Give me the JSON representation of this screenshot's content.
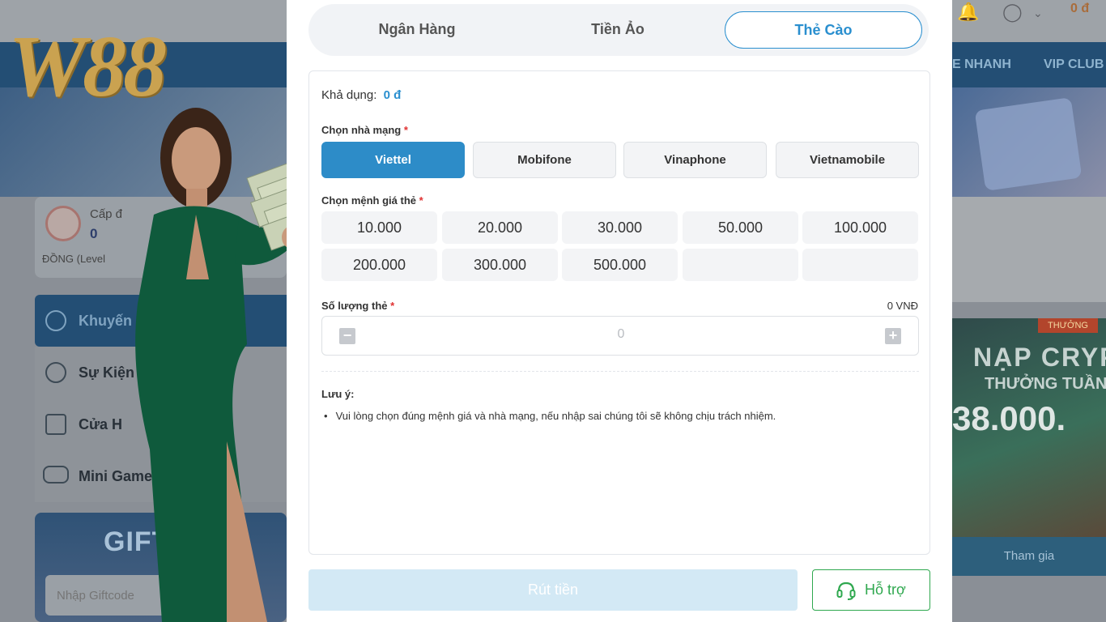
{
  "background": {
    "nav": {
      "items_right": [
        "E NHANH",
        "VIP CLUB"
      ]
    },
    "user_card": {
      "level_label": "Cấp đ",
      "points": "0",
      "level_name": "ĐỒNG (Level"
    },
    "menu": [
      {
        "label": "Khuyến"
      },
      {
        "label": "Sự Kiện"
      },
      {
        "label": "Cửa H"
      },
      {
        "label": "Mini Game"
      }
    ],
    "gift": {
      "title": "GIFT",
      "placeholder": "Nhập Giftcode"
    },
    "promo": {
      "badge": "THƯỞNG",
      "line1": "NẠP CRYP",
      "line2": "THƯỞNG TUẦN",
      "line3": "38.000.",
      "footer": "Tham gia"
    },
    "top_balance": "0 đ",
    "logo_text": "W88"
  },
  "modal": {
    "tabs": [
      {
        "label": "Ngân Hàng",
        "active": false
      },
      {
        "label": "Tiền Ảo",
        "active": false
      },
      {
        "label": "Thẻ Cào",
        "active": true
      }
    ],
    "available": {
      "label": "Khả dụng:",
      "value": "0 đ"
    },
    "carrier_label": "Chọn nhà mạng",
    "carriers": [
      {
        "label": "Viettel",
        "active": true
      },
      {
        "label": "Mobifone",
        "active": false
      },
      {
        "label": "Vinaphone",
        "active": false
      },
      {
        "label": "Vietnamobile",
        "active": false
      }
    ],
    "denomination_label": "Chọn mệnh giá thẻ",
    "denominations": [
      "10.000",
      "20.000",
      "30.000",
      "50.000",
      "100.000",
      "200.000",
      "300.000",
      "500.000",
      "",
      ""
    ],
    "quantity": {
      "label": "Số lượng thẻ",
      "total": "0 VNĐ",
      "value": "0",
      "minus": "−",
      "plus": "+"
    },
    "note": {
      "title": "Lưu ý:",
      "items": [
        "Vui lòng chọn đúng mệnh giá và nhà mạng, nếu nhập sai chúng tôi sẽ không chịu trách nhiệm."
      ]
    },
    "submit_label": "Rút tiền",
    "support_label": "Hỗ trợ",
    "required_mark": "*"
  },
  "colors": {
    "accent": "#2a8fcf",
    "carrier_active": "#2d8cc8",
    "support": "#2fa84f",
    "submit_disabled": "#d3e9f5",
    "required": "#e03131"
  }
}
